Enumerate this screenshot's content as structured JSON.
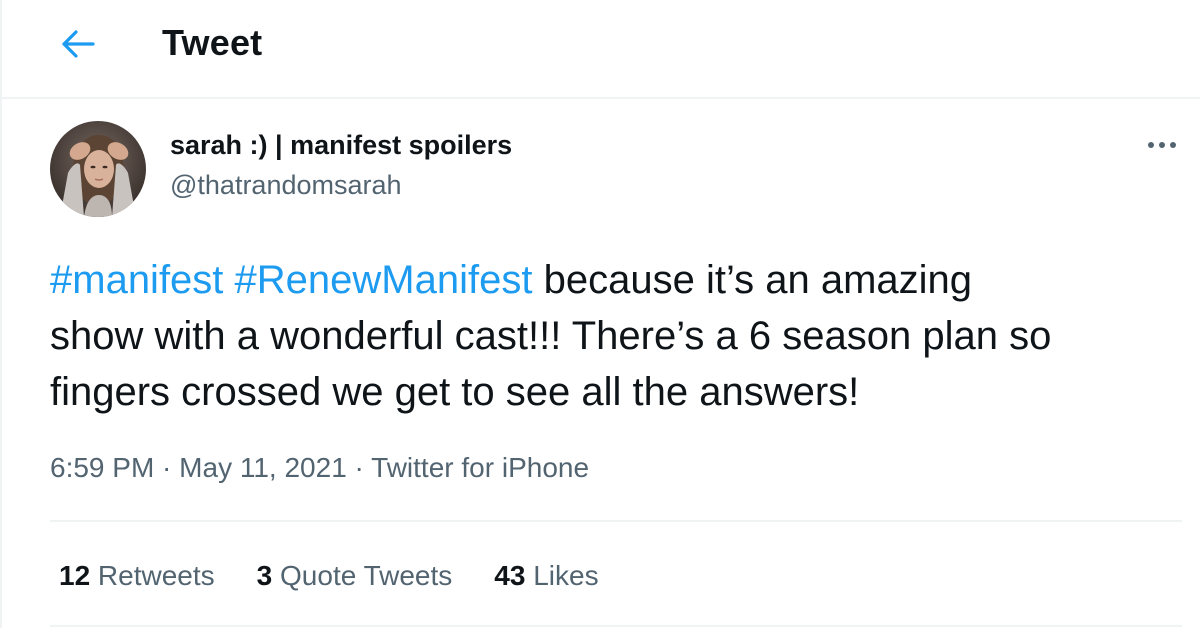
{
  "header": {
    "title": "Tweet",
    "back_icon": "arrow-left-icon"
  },
  "author": {
    "display_name": "sarah :) | manifest spoilers",
    "handle": "@thatrandomsarah"
  },
  "tweet": {
    "hashtag1": "#manifest",
    "hashtag2": "#RenewManifest",
    "text_line1_rest": " because it’s an amazing",
    "text_line2": "show with a wonderful cast!!! There’s a 6 season plan so",
    "text_line3": "fingers crossed we get to see all the answers!"
  },
  "meta": {
    "time": "6:59 PM",
    "sep": " · ",
    "date": "May 11, 2021",
    "source": "Twitter for iPhone"
  },
  "stats": {
    "retweets_count": "12",
    "retweets_label": " Retweets",
    "quotes_count": "3",
    "quotes_label": " Quote Tweets",
    "likes_count": "43",
    "likes_label": " Likes"
  },
  "colors": {
    "accent": "#1d9bf0",
    "text": "#0f1419",
    "secondary": "#536471",
    "border": "#eff3f4"
  }
}
